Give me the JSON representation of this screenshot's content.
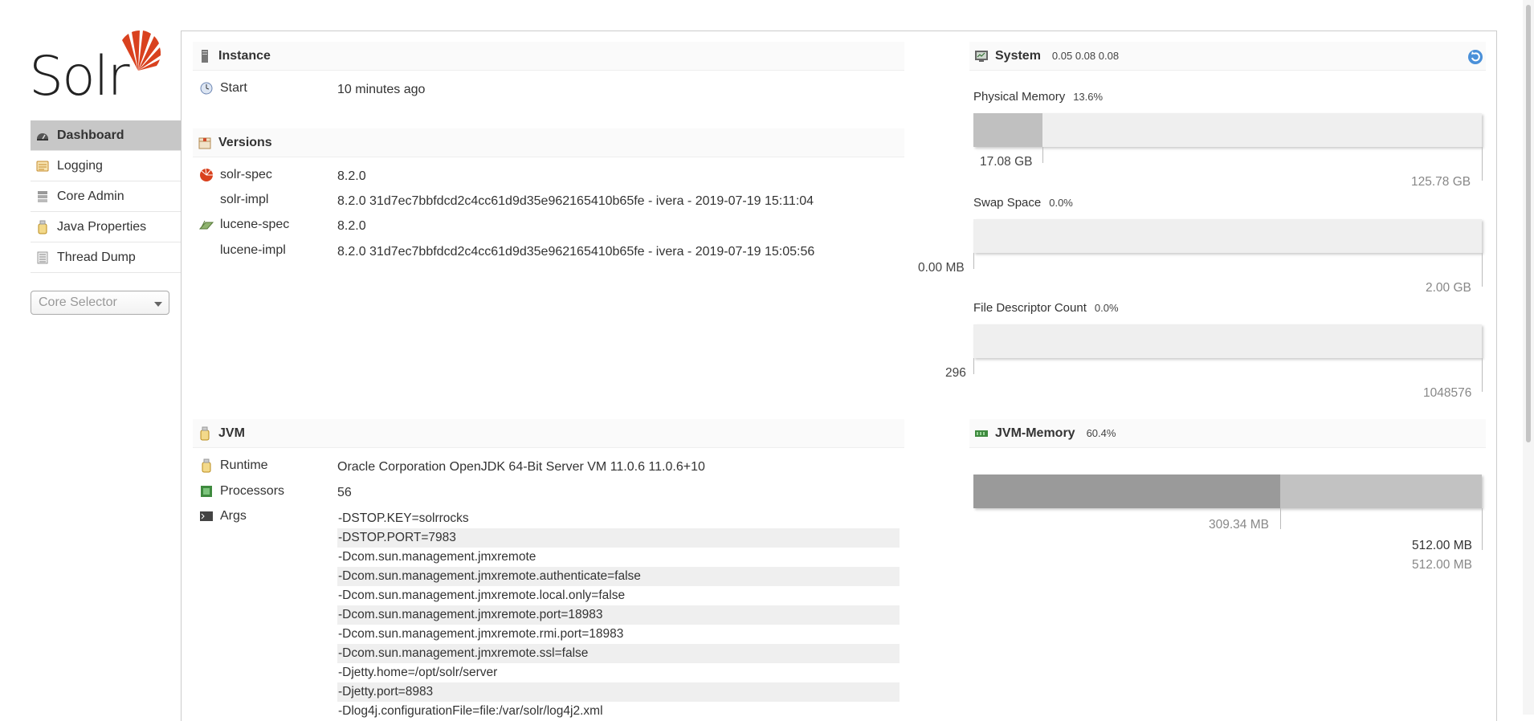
{
  "logo": {
    "text": "Solr"
  },
  "nav": {
    "items": [
      {
        "label": "Dashboard",
        "icon": "dashboard-icon"
      },
      {
        "label": "Logging",
        "icon": "logging-icon"
      },
      {
        "label": "Core Admin",
        "icon": "core-admin-icon"
      },
      {
        "label": "Java Properties",
        "icon": "java-properties-icon"
      },
      {
        "label": "Thread Dump",
        "icon": "thread-dump-icon"
      }
    ],
    "core_selector": "Core Selector"
  },
  "instance": {
    "title": "Instance",
    "start_label": "Start",
    "start_value": "10 minutes ago"
  },
  "versions": {
    "title": "Versions",
    "rows": [
      {
        "label": "solr-spec",
        "value": "8.2.0"
      },
      {
        "label": "solr-impl",
        "value": "8.2.0 31d7ec7bbfdcd2c4cc61d9d35e962165410b65fe - ivera - 2019-07-19 15:11:04"
      },
      {
        "label": "lucene-spec",
        "value": "8.2.0"
      },
      {
        "label": "lucene-impl",
        "value": "8.2.0 31d7ec7bbfdcd2c4cc61d9d35e962165410b65fe - ivera - 2019-07-19 15:05:56"
      }
    ]
  },
  "jvm": {
    "title": "JVM",
    "runtime_label": "Runtime",
    "runtime_value": "Oracle Corporation OpenJDK 64-Bit Server VM 11.0.6 11.0.6+10",
    "processors_label": "Processors",
    "processors_value": "56",
    "args_label": "Args",
    "args": [
      "-DSTOP.KEY=solrrocks",
      "-DSTOP.PORT=7983",
      "-Dcom.sun.management.jmxremote",
      "-Dcom.sun.management.jmxremote.authenticate=false",
      "-Dcom.sun.management.jmxremote.local.only=false",
      "-Dcom.sun.management.jmxremote.port=18983",
      "-Dcom.sun.management.jmxremote.rmi.port=18983",
      "-Dcom.sun.management.jmxremote.ssl=false",
      "-Djetty.home=/opt/solr/server",
      "-Djetty.port=8983",
      "-Dlog4j.configurationFile=file:/var/solr/log4j2.xml"
    ]
  },
  "system": {
    "title": "System",
    "load": "0.05 0.08 0.08",
    "physical_memory": {
      "title": "Physical Memory",
      "pct": "13.6%",
      "fraction": 0.136,
      "used": "17.08 GB",
      "total": "125.78 GB"
    },
    "swap_space": {
      "title": "Swap Space",
      "pct": "0.0%",
      "fraction": 0.0,
      "used": "0.00 MB",
      "total": "2.00 GB"
    },
    "file_descriptors": {
      "title": "File Descriptor Count",
      "pct": "0.0%",
      "fraction": 0.0,
      "used": "296",
      "total": "1048576"
    }
  },
  "jvm_memory": {
    "title": "JVM-Memory",
    "pct": "60.4%",
    "used_fraction": 0.604,
    "used": "309.34 MB",
    "committed": "512.00 MB",
    "max": "512.00 MB"
  },
  "colors": {
    "active_nav": "#c7c7c7",
    "bar_bg": "#efefef",
    "phys_fill": "#c0c0c0",
    "jvm_used": "#9a9a9a",
    "jvm_committed": "#c2c2c2"
  }
}
